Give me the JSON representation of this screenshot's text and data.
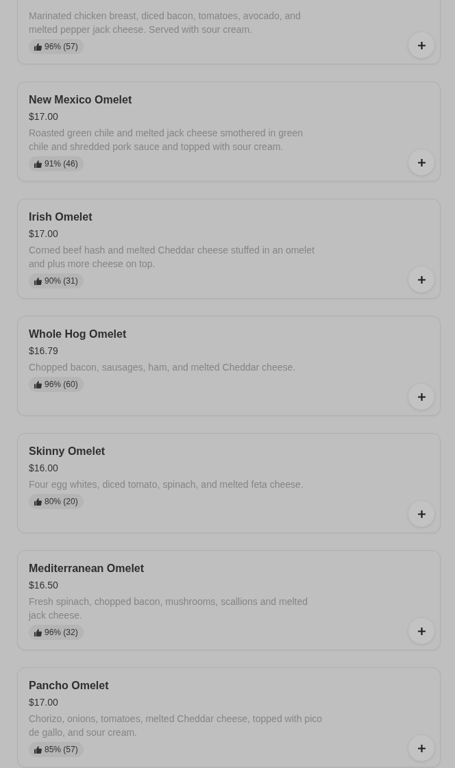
{
  "items": [
    {
      "description": "Marinated chicken breast, diced bacon, tomatoes, avocado, and melted pepper jack cheese. Served with sour cream.",
      "rating": "96% (57)"
    },
    {
      "name": "New Mexico Omelet",
      "price": "$17.00",
      "description": "Roasted green chile and melted jack cheese smothered in green chile and shredded pork sauce and topped with sour cream.",
      "rating": "91% (46)"
    },
    {
      "name": "Irish Omelet",
      "price": "$17.00",
      "description": "Corned beef hash and melted Cheddar cheese stuffed in an omelet and plus more cheese on top.",
      "rating": "90% (31)"
    },
    {
      "name": "Whole Hog Omelet",
      "price": "$16.79",
      "description": "Chopped bacon, sausages, ham, and melted Cheddar cheese.",
      "rating": "96% (60)"
    },
    {
      "name": "Skinny Omelet",
      "price": "$16.00",
      "description": "Four egg whites, diced tomato, spinach, and melted feta cheese.",
      "rating": "80% (20)"
    },
    {
      "name": "Mediterranean Omelet",
      "price": "$16.50",
      "description": "Fresh spinach, chopped bacon, mushrooms, scallions and melted jack cheese.",
      "rating": "96% (32)"
    },
    {
      "name": "Pancho Omelet",
      "price": "$17.00",
      "description": "Chorizo, onions, tomatoes, melted Cheddar cheese, topped with pico de gallo, and sour cream.",
      "rating": "85% (57)"
    }
  ]
}
